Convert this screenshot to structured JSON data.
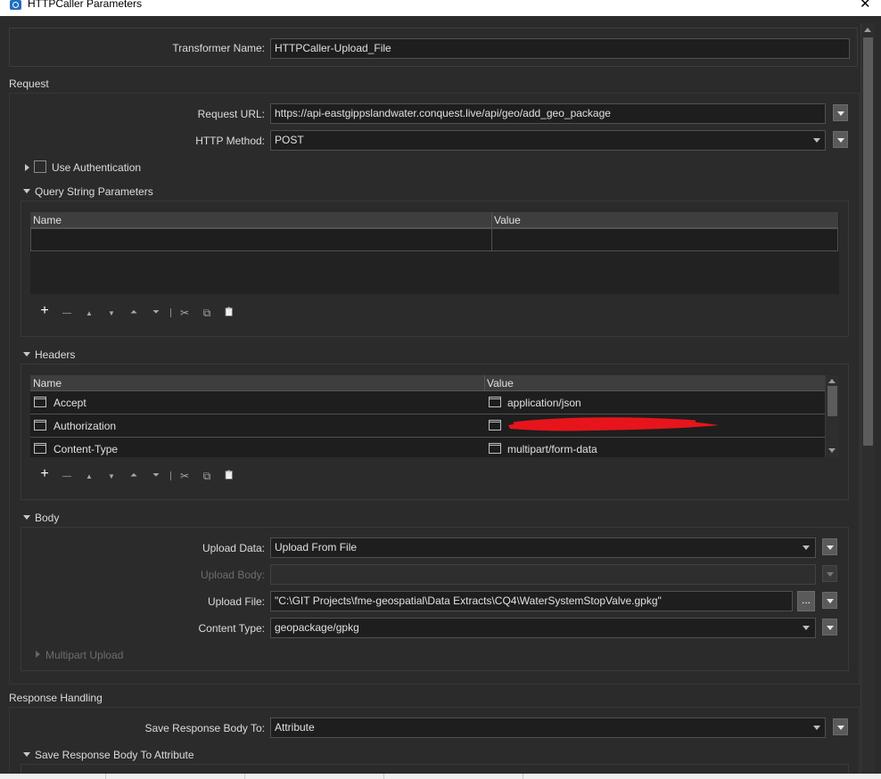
{
  "window": {
    "title": "HTTPCaller Parameters",
    "close_glyph": "✕"
  },
  "transformer": {
    "label": "Transformer Name:",
    "value": "HTTPCaller-Upload_File"
  },
  "request": {
    "section_label": "Request",
    "url_label": "Request URL:",
    "url_value": "https://api-eastgippslandwater.conquest.live/api/geo/add_geo_package",
    "method_label": "HTTP Method:",
    "method_value": "POST",
    "use_auth_label": "Use Authentication",
    "use_auth_checked": false
  },
  "query_params": {
    "section_label": "Query String Parameters",
    "columns": [
      "Name",
      "Value"
    ],
    "rows": []
  },
  "headers": {
    "section_label": "Headers",
    "columns": [
      "Name",
      "Value"
    ],
    "rows": [
      {
        "name": "Accept",
        "value": "application/json"
      },
      {
        "name": "Authorization",
        "value": ""
      },
      {
        "name": "Content-Type",
        "value": "multipart/form-data"
      }
    ]
  },
  "toolbar": {
    "add": "+",
    "remove": "—",
    "move_up": "▲",
    "move_down": "▼",
    "move_top": "⏶",
    "move_bottom": "⏷",
    "cut": "✂",
    "copy": "⧉",
    "paste": "📋"
  },
  "body": {
    "section_label": "Body",
    "upload_data_label": "Upload Data:",
    "upload_data_value": "Upload From File",
    "upload_body_label": "Upload Body:",
    "upload_body_value": "",
    "upload_file_label": "Upload File:",
    "upload_file_value": "\"C:\\GIT Projects\\fme-geospatial\\Data Extracts\\CQ4\\WaterSystemStopValve.gpkg\"",
    "browse_label": "...",
    "content_type_label": "Content Type:",
    "content_type_value": "geopackage/gpkg",
    "multipart_label": "Multipart Upload"
  },
  "response": {
    "section_label": "Response Handling",
    "save_to_label": "Save Response Body To:",
    "save_to_value": "Attribute",
    "save_attr_section": "Save Response Body To Attribute"
  },
  "icons": {
    "expand": "chevron-right-icon",
    "collapse": "chevron-down-icon",
    "menu": "dropdown-menu-icon"
  },
  "colors": {
    "background": "#2b2b2b",
    "field": "#1e1e1e",
    "redaction": "#e8141c"
  }
}
